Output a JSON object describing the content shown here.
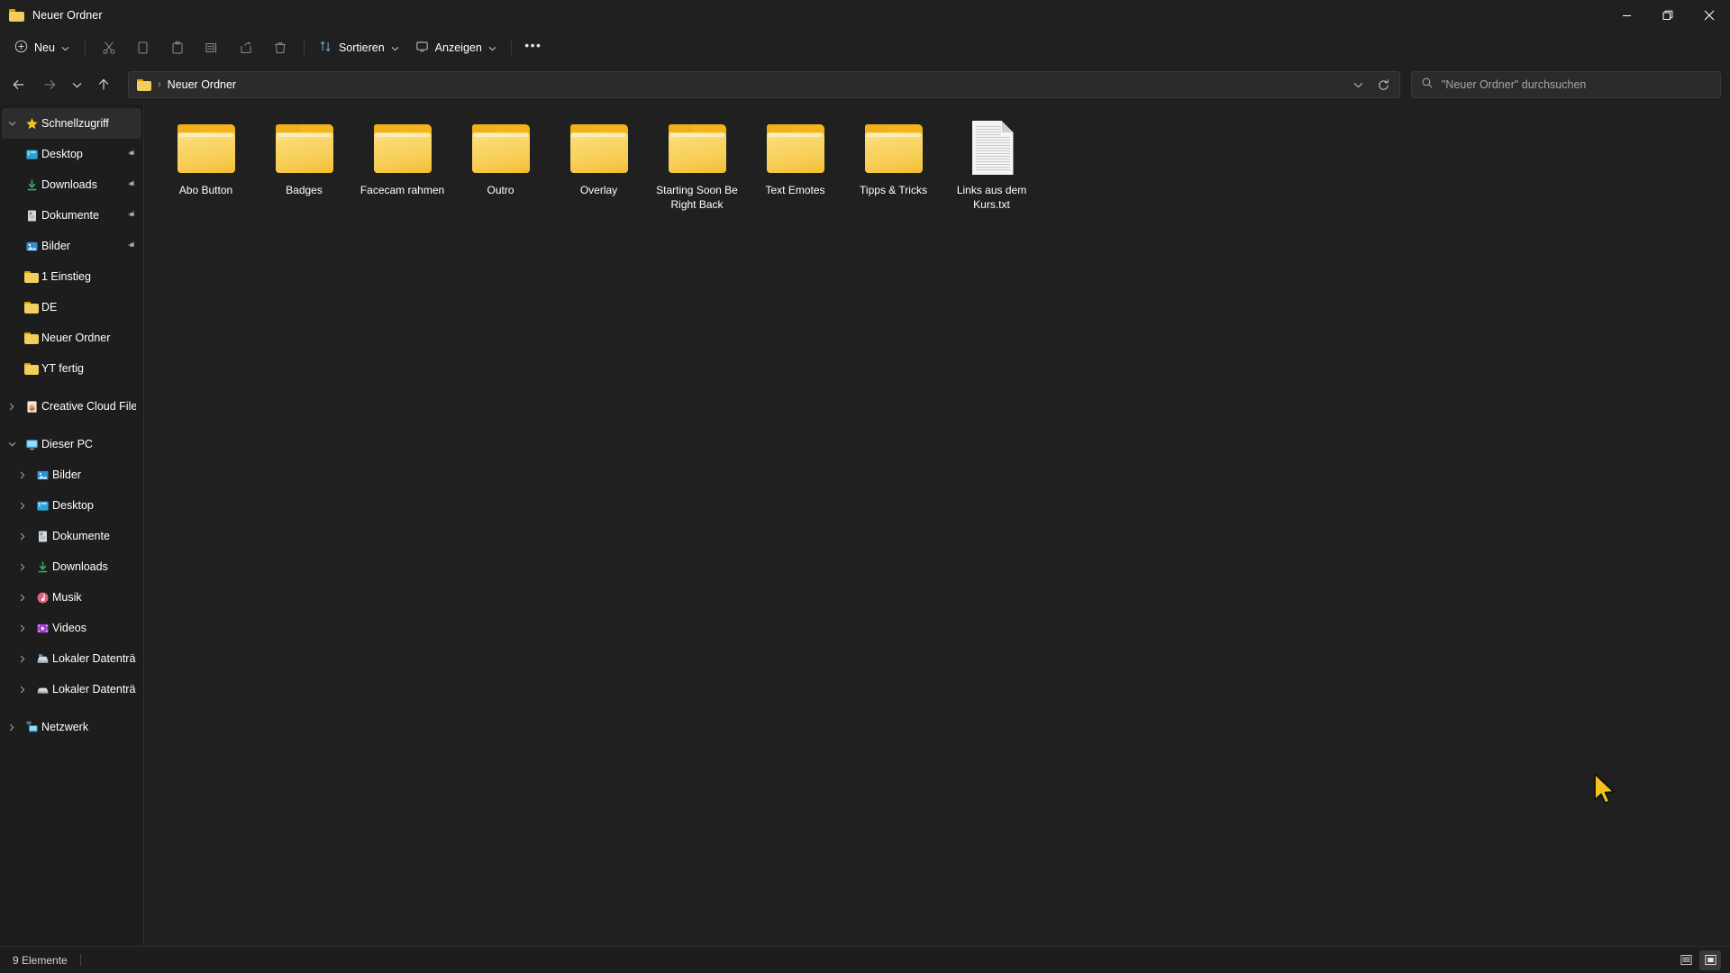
{
  "window": {
    "title": "Neuer Ordner",
    "folder_icon": "folder-icon",
    "controls": {
      "minimize": "minimize-icon",
      "maximize": "restore-icon",
      "close": "close-icon"
    }
  },
  "toolbar": {
    "new_label": "Neu",
    "new_icon": "plus-circle-icon",
    "cut_icon": "scissors-icon",
    "copy_icon": "copy-icon",
    "paste_icon": "paste-icon",
    "rename_icon": "rename-icon",
    "share_icon": "share-icon",
    "delete_icon": "trash-icon",
    "sort_label": "Sortieren",
    "sort_icon": "sort-arrows-icon",
    "view_label": "Anzeigen",
    "view_icon": "monitor-icon",
    "more_label": "•••"
  },
  "address": {
    "back_icon": "arrow-left-icon",
    "forward_icon": "arrow-right-icon",
    "recent_icon": "chevron-down-icon",
    "up_icon": "arrow-up-icon",
    "breadcrumb": [
      "Neuer Ordner"
    ],
    "breadcrumb_separator": "›",
    "dropdown_icon": "chevron-down-icon",
    "refresh_icon": "refresh-icon"
  },
  "search": {
    "icon": "search-icon",
    "placeholder": "\"Neuer Ordner\" durchsuchen",
    "value": ""
  },
  "sidebar": {
    "groups": [
      {
        "header": {
          "label": "Schnellzugriff",
          "icon": "star-icon",
          "expanded": true,
          "selected": true
        },
        "items": [
          {
            "label": "Desktop",
            "icon": "desktop-icon",
            "pinned": true
          },
          {
            "label": "Downloads",
            "icon": "downloads-icon",
            "pinned": true
          },
          {
            "label": "Dokumente",
            "icon": "documents-icon",
            "pinned": true
          },
          {
            "label": "Bilder",
            "icon": "pictures-icon",
            "pinned": true
          },
          {
            "label": "1 Einstieg",
            "icon": "folder-icon",
            "pinned": false
          },
          {
            "label": "DE",
            "icon": "folder-icon",
            "pinned": false
          },
          {
            "label": "Neuer Ordner",
            "icon": "folder-icon",
            "pinned": false
          },
          {
            "label": "YT fertig",
            "icon": "folder-icon",
            "pinned": false
          }
        ]
      },
      {
        "header": {
          "label": "Creative Cloud Files",
          "icon": "creative-cloud-icon",
          "expanded": false,
          "selected": false
        },
        "items": []
      },
      {
        "header": {
          "label": "Dieser PC",
          "icon": "this-pc-icon",
          "expanded": true,
          "selected": false
        },
        "items": [
          {
            "label": "Bilder",
            "icon": "pictures-icon",
            "expandable": true
          },
          {
            "label": "Desktop",
            "icon": "desktop-icon",
            "expandable": true
          },
          {
            "label": "Dokumente",
            "icon": "documents-icon",
            "expandable": true
          },
          {
            "label": "Downloads",
            "icon": "downloads-icon",
            "expandable": true
          },
          {
            "label": "Musik",
            "icon": "music-icon",
            "expandable": true
          },
          {
            "label": "Videos",
            "icon": "videos-icon",
            "expandable": true
          },
          {
            "label": "Lokaler Datenträger",
            "icon": "local-disk-icon",
            "expandable": true
          },
          {
            "label": "Lokaler Datenträger",
            "icon": "local-disk-icon",
            "expandable": true
          }
        ]
      },
      {
        "header": {
          "label": "Netzwerk",
          "icon": "network-icon",
          "expanded": false,
          "selected": false
        },
        "items": []
      }
    ]
  },
  "files": [
    {
      "name": "Abo Button",
      "type": "folder"
    },
    {
      "name": "Badges",
      "type": "folder"
    },
    {
      "name": "Facecam rahmen",
      "type": "folder"
    },
    {
      "name": "Outro",
      "type": "folder"
    },
    {
      "name": "Overlay",
      "type": "folder"
    },
    {
      "name": "Starting Soon Be Right Back",
      "type": "folder"
    },
    {
      "name": "Text Emotes",
      "type": "folder"
    },
    {
      "name": "Tipps & Tricks",
      "type": "folder"
    },
    {
      "name": "Links aus dem Kurs.txt",
      "type": "textfile"
    }
  ],
  "status": {
    "item_count": "9 Elemente",
    "details_view_icon": "details-view-icon",
    "icons_view_icon": "large-icons-view-icon",
    "active_view": "large-icons"
  },
  "colors": {
    "window_bg": "#202020",
    "sidebar_bg": "#1d1d1d",
    "folder_yellow": "#f7cc53",
    "folder_tab": "#f0b018",
    "accent": "#4cc2ff",
    "cursor": "#f2c41c"
  }
}
